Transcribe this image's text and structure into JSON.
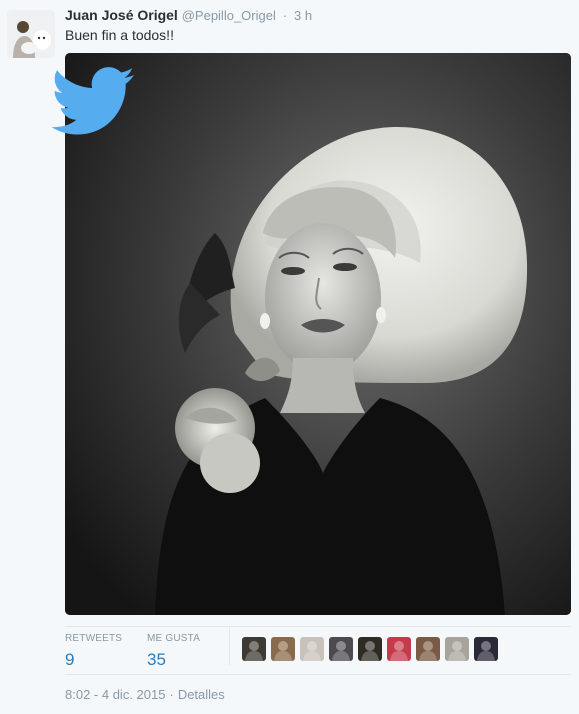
{
  "tweet": {
    "fullname": "Juan José Origel",
    "handle": "@Pepillo_Origel",
    "separator": "·",
    "time_ago": "3 h",
    "text": "Buen fin a todos!!"
  },
  "stats": {
    "retweets_label": "RETWEETS",
    "retweets_count": "9",
    "likes_label": "ME GUSTA",
    "likes_count": "35"
  },
  "likers": [
    {
      "name": "liker-avatar-1",
      "color": "#3d3a33"
    },
    {
      "name": "liker-avatar-2",
      "color": "#8a6a4c"
    },
    {
      "name": "liker-avatar-3",
      "color": "#c9c1ba"
    },
    {
      "name": "liker-avatar-4",
      "color": "#4c4a4e"
    },
    {
      "name": "liker-avatar-5",
      "color": "#2f2b22"
    },
    {
      "name": "liker-avatar-6",
      "color": "#c53b4b"
    },
    {
      "name": "liker-avatar-7",
      "color": "#7a5a44"
    },
    {
      "name": "liker-avatar-8",
      "color": "#a8a49c"
    },
    {
      "name": "liker-avatar-9",
      "color": "#2b2838"
    }
  ],
  "footer": {
    "timestamp": "8:02 - 4 dic. 2015",
    "separator": "·",
    "details_label": "Detalles"
  },
  "colors": {
    "accent": "#2b7bb9",
    "twitter_blue": "#55acee",
    "text": "#292f33",
    "muted": "#8899a6"
  }
}
